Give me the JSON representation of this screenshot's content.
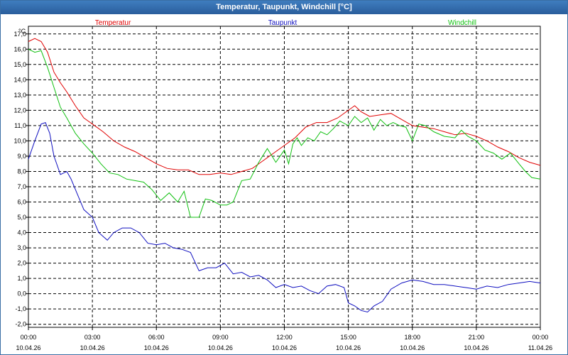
{
  "window": {
    "title": "Temperatur, Taupunkt, Windchill [°C]"
  },
  "chart_data": {
    "type": "line",
    "title": "Temperatur, Taupunkt, Windchill [°C]",
    "ylabel": "°C",
    "ylim": [
      -2.2,
      17.5
    ],
    "xlim": [
      0,
      24
    ],
    "grid": true,
    "legend_position": "top",
    "y_ticks": [
      "-2,0",
      "-1,0",
      "0,0",
      "1,0",
      "2,0",
      "3,0",
      "4,0",
      "5,0",
      "6,0",
      "7,0",
      "8,0",
      "9,0",
      "10,0",
      "11,0",
      "12,0",
      "13,0",
      "14,0",
      "15,0",
      "16,0",
      "17,0"
    ],
    "y_tick_values": [
      -2,
      -1,
      0,
      1,
      2,
      3,
      4,
      5,
      6,
      7,
      8,
      9,
      10,
      11,
      12,
      13,
      14,
      15,
      16,
      17
    ],
    "x_ticks": [
      {
        "time": "00:00",
        "date": "10.04.26"
      },
      {
        "time": "03:00",
        "date": "10.04.26"
      },
      {
        "time": "06:00",
        "date": "10.04.26"
      },
      {
        "time": "09:00",
        "date": "10.04.26"
      },
      {
        "time": "12:00",
        "date": "10.04.26"
      },
      {
        "time": "15:00",
        "date": "10.04.26"
      },
      {
        "time": "18:00",
        "date": "10.04.26"
      },
      {
        "time": "21:00",
        "date": "10.04.26"
      },
      {
        "time": "00:00",
        "date": "11.04.26"
      }
    ],
    "x_tick_hours": [
      0,
      3,
      6,
      9,
      12,
      15,
      18,
      21,
      24
    ],
    "x_unit": "hours since 10.04.26 00:00",
    "series": [
      {
        "name": "Temperatur",
        "color": "#e00000",
        "x": [
          0,
          0.3,
          0.6,
          0.9,
          1.2,
          1.5,
          1.8,
          2.2,
          2.6,
          3.0,
          3.5,
          4.0,
          4.5,
          5.0,
          5.5,
          6.0,
          6.5,
          7.0,
          7.5,
          8.0,
          8.5,
          9.0,
          9.5,
          10.0,
          10.5,
          11.0,
          11.5,
          12.0,
          12.5,
          13.0,
          13.5,
          14.0,
          14.5,
          15.0,
          15.3,
          15.6,
          16.0,
          16.5,
          17.0,
          17.5,
          18.0,
          18.5,
          19.0,
          19.5,
          20.0,
          20.5,
          21.0,
          21.5,
          22.0,
          22.5,
          23.0,
          23.5,
          24.0
        ],
        "y": [
          16.5,
          16.7,
          16.5,
          15.8,
          14.5,
          13.8,
          13.2,
          12.3,
          11.5,
          11.1,
          10.6,
          10.0,
          9.6,
          9.3,
          8.9,
          8.5,
          8.2,
          8.1,
          8.1,
          7.8,
          7.8,
          7.9,
          7.8,
          8.0,
          8.2,
          8.7,
          9.2,
          9.7,
          10.2,
          10.9,
          11.2,
          11.2,
          11.5,
          12.0,
          12.3,
          11.9,
          11.6,
          11.7,
          11.8,
          11.4,
          11.0,
          10.9,
          10.8,
          10.6,
          10.4,
          10.5,
          10.3,
          10.0,
          9.6,
          9.3,
          8.9,
          8.6,
          8.4
        ]
      },
      {
        "name": "Taupunkt",
        "color": "#1010c0",
        "x": [
          0,
          0.3,
          0.6,
          0.8,
          1.0,
          1.2,
          1.5,
          1.8,
          2.0,
          2.3,
          2.6,
          3.0,
          3.3,
          3.7,
          4.0,
          4.4,
          4.8,
          5.2,
          5.6,
          6.0,
          6.4,
          6.8,
          7.2,
          7.6,
          8.0,
          8.4,
          8.8,
          9.2,
          9.6,
          10.0,
          10.4,
          10.8,
          11.2,
          11.6,
          12.0,
          12.4,
          12.8,
          13.2,
          13.6,
          14.0,
          14.4,
          14.8,
          15.0,
          15.3,
          15.6,
          15.9,
          16.2,
          16.6,
          17.0,
          17.5,
          18.0,
          18.5,
          19.0,
          19.5,
          20.0,
          20.5,
          21.0,
          21.5,
          22.0,
          22.5,
          23.0,
          23.5,
          24.0
        ],
        "y": [
          8.8,
          10.0,
          11.1,
          11.2,
          10.5,
          9.0,
          7.8,
          8.0,
          7.5,
          6.5,
          5.5,
          5.0,
          4.0,
          3.5,
          4.0,
          4.3,
          4.3,
          4.0,
          3.3,
          3.2,
          3.3,
          3.0,
          2.9,
          2.7,
          1.5,
          1.7,
          1.7,
          2.0,
          1.3,
          1.4,
          1.1,
          1.2,
          0.9,
          0.4,
          0.6,
          0.4,
          0.5,
          0.2,
          0.0,
          0.5,
          0.6,
          0.4,
          -0.6,
          -0.8,
          -1.1,
          -1.2,
          -0.8,
          -0.5,
          0.3,
          0.7,
          0.9,
          0.8,
          0.6,
          0.6,
          0.5,
          0.4,
          0.3,
          0.5,
          0.4,
          0.6,
          0.7,
          0.8,
          0.7
        ]
      },
      {
        "name": "Windchill",
        "color": "#10c010",
        "x": [
          0,
          0.3,
          0.6,
          0.9,
          1.2,
          1.5,
          1.8,
          2.2,
          2.6,
          3.0,
          3.4,
          3.8,
          4.2,
          4.6,
          5.0,
          5.4,
          5.8,
          6.2,
          6.6,
          7.0,
          7.3,
          7.6,
          8.0,
          8.3,
          8.6,
          9.0,
          9.3,
          9.6,
          10.0,
          10.4,
          10.8,
          11.2,
          11.6,
          12.0,
          12.2,
          12.4,
          12.6,
          12.8,
          13.1,
          13.4,
          13.7,
          14.0,
          14.3,
          14.6,
          15.0,
          15.3,
          15.6,
          15.9,
          16.2,
          16.5,
          16.8,
          17.1,
          17.4,
          17.7,
          18.0,
          18.3,
          18.6,
          19.0,
          19.5,
          20.0,
          20.3,
          20.6,
          21.0,
          21.4,
          21.8,
          22.2,
          22.6,
          23.0,
          23.3,
          23.6,
          24.0
        ],
        "y": [
          16.0,
          15.8,
          15.9,
          14.8,
          13.5,
          12.2,
          11.5,
          10.5,
          9.8,
          9.2,
          8.5,
          7.9,
          7.8,
          7.5,
          7.4,
          7.3,
          6.8,
          6.1,
          6.6,
          6.0,
          6.7,
          5.0,
          5.0,
          6.2,
          6.1,
          5.8,
          5.8,
          6.0,
          7.4,
          7.5,
          8.6,
          9.5,
          8.6,
          9.4,
          8.5,
          9.8,
          10.2,
          9.7,
          10.2,
          10.0,
          10.6,
          10.4,
          10.8,
          11.3,
          11.0,
          11.6,
          11.2,
          11.5,
          10.7,
          11.4,
          11.0,
          11.2,
          11.0,
          10.9,
          10.0,
          11.1,
          11.0,
          10.6,
          10.3,
          10.2,
          10.7,
          10.3,
          10.0,
          9.4,
          9.2,
          8.8,
          9.2,
          8.5,
          8.0,
          7.6,
          7.5
        ]
      }
    ]
  }
}
